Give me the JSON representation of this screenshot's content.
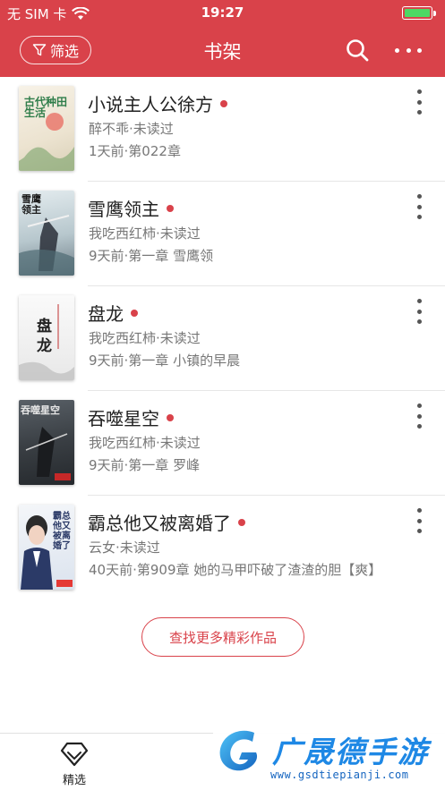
{
  "status_bar": {
    "carrier": "无 SIM 卡",
    "time": "19:27",
    "battery_level": 1.0
  },
  "nav": {
    "filter_label": "筛选",
    "title": "书架"
  },
  "books": [
    {
      "title": "小说主人公徐方",
      "author": "醉不乖·未读过",
      "latest": "1天前·第022章",
      "unread_dot": true,
      "cover": {
        "bg": "#f3ede2",
        "accent": "#2f7d4a",
        "text": "古代种田生活"
      }
    },
    {
      "title": "雪鹰领主",
      "author": "我吃西红柿·未读过",
      "latest": "9天前·第一章 雪鹰领",
      "unread_dot": true,
      "cover": {
        "bg": "#c9d6db",
        "accent": "#2a2f38",
        "text": "雪鹰领主"
      }
    },
    {
      "title": "盘龙",
      "author": "我吃西红柿·未读过",
      "latest": "9天前·第一章 小镇的早晨",
      "unread_dot": true,
      "cover": {
        "bg": "#eeeeee",
        "accent": "#333333",
        "text": "盘龙"
      }
    },
    {
      "title": "吞噬星空",
      "author": "我吃西红柿·未读过",
      "latest": "9天前·第一章 罗峰",
      "unread_dot": true,
      "cover": {
        "bg": "#3d4449",
        "accent": "#d9d9d9",
        "text": "吞噬星空"
      }
    },
    {
      "title": "霸总他又被离婚了",
      "author": "云女·未读过",
      "latest": "40天前·第909章 她的马甲吓破了渣渣的胆【爽】",
      "unread_dot": true,
      "cover": {
        "bg": "#e9eef4",
        "accent": "#2b3a67",
        "text": "霸总他又被离婚了"
      }
    }
  ],
  "find_more_label": "查找更多精彩作品",
  "tab_bar": {
    "featured_label": "精选"
  },
  "watermark": {
    "brand": "广晟德手游",
    "url": "www.gsdtiepianji.com"
  },
  "colors": {
    "brand_red": "#d9424a",
    "text_dark": "#222222",
    "text_muted": "#777777",
    "battery_green": "#4cd964",
    "watermark_blue": "#1e88e5"
  }
}
